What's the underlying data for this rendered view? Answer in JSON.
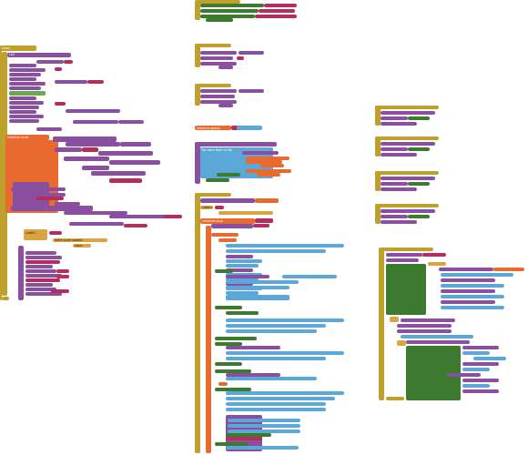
{
  "workspace": {
    "background": "#ffffff"
  },
  "colors": {
    "event": "#c0a02c",
    "procedure": "#8a4f9e",
    "component": "#3b7a2f",
    "text": "#b32d5e",
    "math": "#3c5bb8",
    "variable": "#e0793b",
    "logic": "#6aa84f",
    "control": "#d9a441",
    "lists": "#5ba8d8",
    "local": "#e86a2e",
    "gray": "#808080"
  },
  "texts": {
    "when": "when",
    "do": "do",
    "call": "call",
    "set": "set",
    "to": "to",
    "if": "if",
    "then": "then",
    "else": "else",
    "get": "get",
    "initialize_global": "initialize global",
    "initialize_local": "initialize local",
    "in": "in",
    "for_each_item": "for each item in list",
    "join": "join",
    "labelA": "Label1",
    "textA": "Text",
    "infile_none": "Infile none loaded",
    "nope": "nope"
  }
}
